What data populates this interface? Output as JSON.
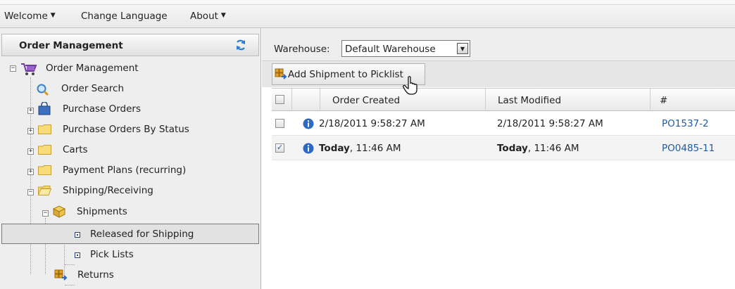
{
  "menubar": {
    "items": [
      {
        "label": "Welcome",
        "has_caret": true
      },
      {
        "label": "Change Language",
        "has_caret": false
      },
      {
        "label": "About",
        "has_caret": true
      }
    ]
  },
  "left_panel": {
    "title": "Order Management",
    "refresh_icon": "refresh-icon",
    "tree": {
      "root": "Order Management",
      "order_search": "Order Search",
      "purchase_orders": "Purchase Orders",
      "purchase_orders_by_status": "Purchase Orders By Status",
      "carts": "Carts",
      "payment_plans": "Payment Plans (recurring)",
      "shipping_receiving": "Shipping/Receiving",
      "shipments": "Shipments",
      "released_for_shipping": "Released for Shipping",
      "pick_lists": "Pick Lists",
      "returns": "Returns"
    }
  },
  "right_panel": {
    "warehouse_label": "Warehouse:",
    "warehouse_value": "Default Warehouse",
    "add_button_label": "Add Shipment to Picklist",
    "columns": {
      "order_created": "Order Created",
      "last_modified": "Last Modified",
      "number": "#"
    },
    "rows": [
      {
        "checked": false,
        "created_bold": "",
        "created_rest": "2/18/2011 9:58:27 AM",
        "modified_bold": "",
        "modified_rest": "2/18/2011 9:58:27 AM",
        "number": "PO1537-2"
      },
      {
        "checked": true,
        "created_bold": "Today",
        "created_rest": ", 11:46 AM",
        "modified_bold": "Today",
        "modified_rest": ", 11:46 AM",
        "number": "PO0485-11"
      }
    ]
  },
  "colors": {
    "link": "#1f5ba6",
    "folder": "#f5d35a",
    "info": "#2c68c4",
    "selected_row": "#e2e2e2"
  }
}
